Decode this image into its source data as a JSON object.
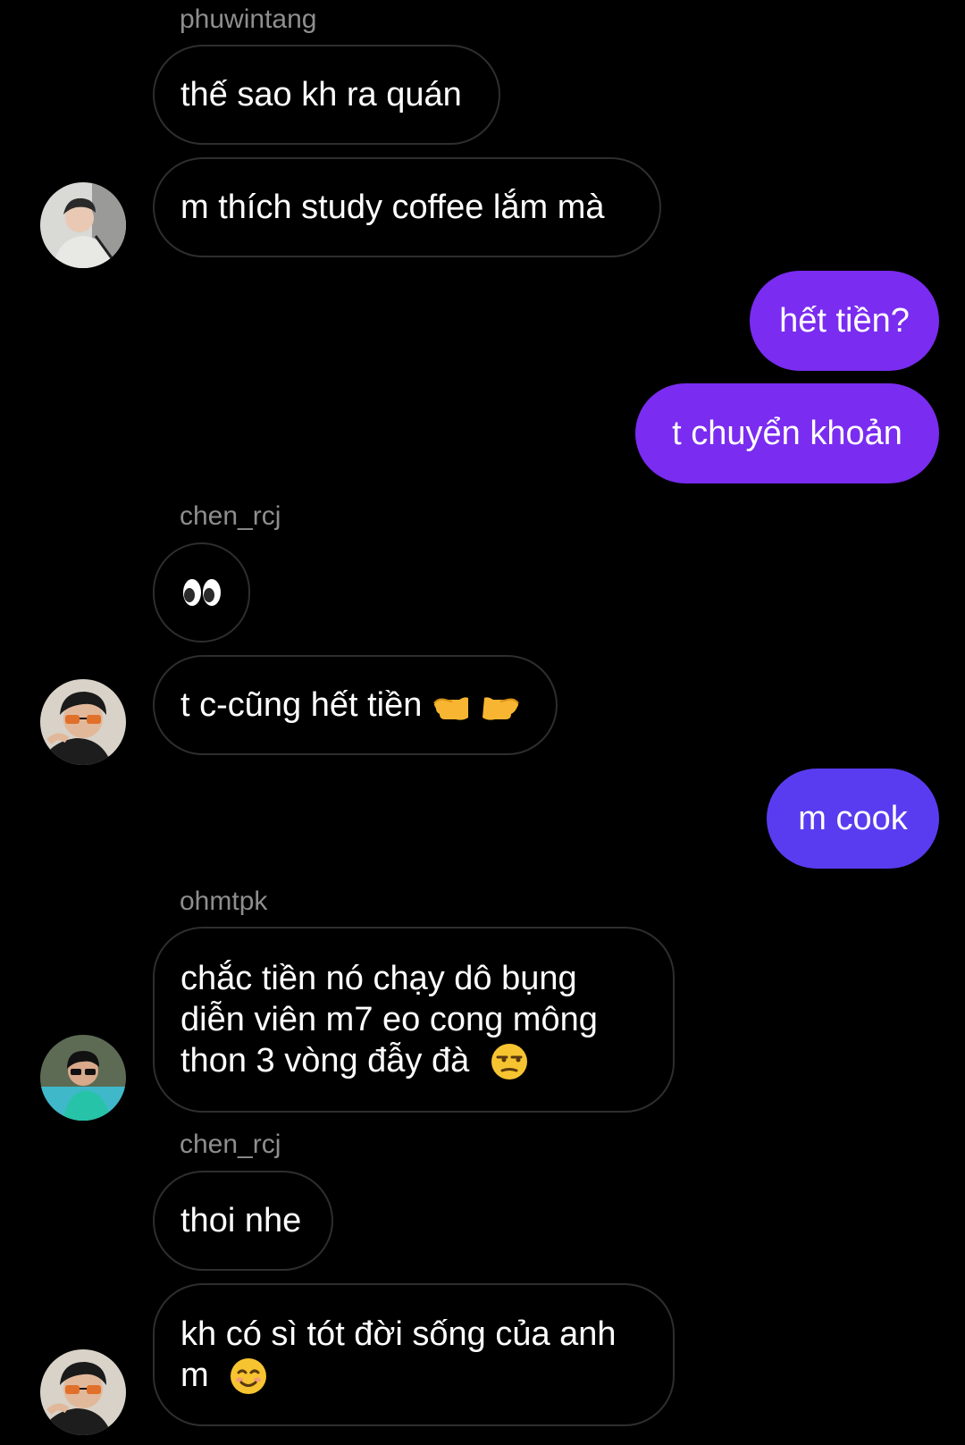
{
  "colors": {
    "background": "#000000",
    "incoming_border": "#2e2e2e",
    "outgoing_violet": "#7a2cf0",
    "outgoing_indigo": "#5a3cf0",
    "sender_gray": "#8e8e8e"
  },
  "messages": [
    {
      "sender": "phuwintang",
      "text": "thế sao kh ra quán"
    },
    {
      "text": "m thích study coffee lắm mà",
      "avatar": "avatar-phuwintang"
    },
    {
      "outgoing": true,
      "text": "hết tiền?"
    },
    {
      "outgoing": true,
      "text": "t chuyển khoản"
    },
    {
      "sender": "chen_rcj",
      "emoji": "eyes-emoji"
    },
    {
      "text": "t c-cũng hết tiền",
      "emoji": "pointing-hands-emoji",
      "avatar": "avatar-chen_rcj"
    },
    {
      "outgoing": true,
      "text": "m cook"
    },
    {
      "sender": "ohmtpk",
      "text_lines": [
        "chắc tiền nó chạy dô bụng",
        "diễn viên m7 eo cong mông",
        "thon 3 vòng đẫy đà"
      ],
      "emoji": "unamused-face-emoji",
      "avatar": "avatar-ohmtpk"
    },
    {
      "sender": "chen_rcj",
      "text": "thoi nhe"
    },
    {
      "text_lines": [
        "kh có sì tót đời sống của anh",
        "m"
      ],
      "emoji": "smiling-face-emoji",
      "avatar": "avatar-chen_rcj"
    }
  ]
}
